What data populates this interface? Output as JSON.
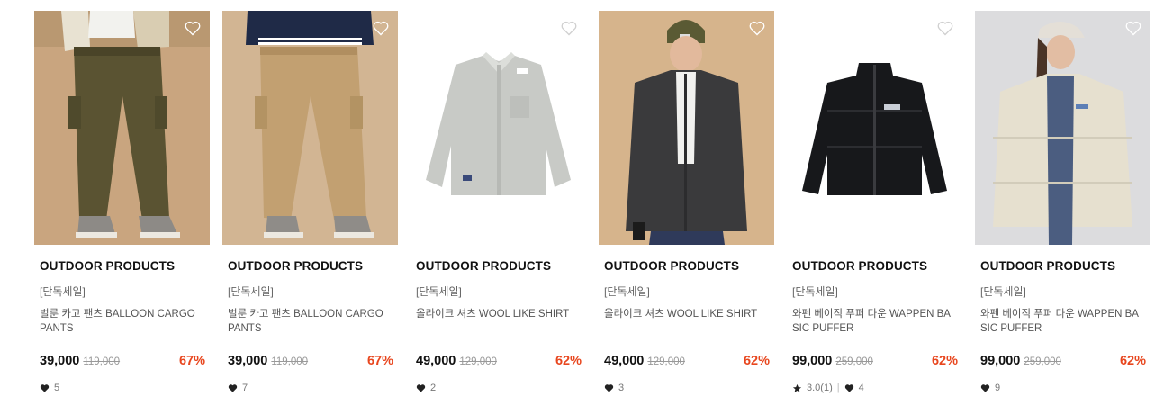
{
  "products": [
    {
      "brand": "OUTDOOR PRODUCTS",
      "tag": "[단독세일]",
      "name": "벌룬 카고 팬츠 BALLOON CARGO PANTS",
      "price": "39,000",
      "orig": "119,000",
      "discount": "67%",
      "likes": "5",
      "rating": "",
      "reviews": ""
    },
    {
      "brand": "OUTDOOR PRODUCTS",
      "tag": "[단독세일]",
      "name": "벌룬 카고 팬츠 BALLOON CARGO PANTS",
      "price": "39,000",
      "orig": "119,000",
      "discount": "67%",
      "likes": "7",
      "rating": "",
      "reviews": ""
    },
    {
      "brand": "OUTDOOR PRODUCTS",
      "tag": "[단독세일]",
      "name": "올라이크 셔츠 WOOL LIKE SHIRT",
      "price": "49,000",
      "orig": "129,000",
      "discount": "62%",
      "likes": "2",
      "rating": "",
      "reviews": ""
    },
    {
      "brand": "OUTDOOR PRODUCTS",
      "tag": "[단독세일]",
      "name": "올라이크 셔츠 WOOL LIKE SHIRT",
      "price": "49,000",
      "orig": "129,000",
      "discount": "62%",
      "likes": "3",
      "rating": "",
      "reviews": ""
    },
    {
      "brand": "OUTDOOR PRODUCTS",
      "tag": "[단독세일]",
      "name": "와펜 베이직 푸퍼 다운 WAPPEN BASIC PUFFER",
      "price": "99,000",
      "orig": "259,000",
      "discount": "62%",
      "likes": "4",
      "rating": "3.0",
      "reviews": "(1)"
    },
    {
      "brand": "OUTDOOR PRODUCTS",
      "tag": "[단독세일]",
      "name": "와펜 베이직 푸퍼 다운 WAPPEN BASIC PUFFER",
      "price": "99,000",
      "orig": "259,000",
      "discount": "62%",
      "likes": "9",
      "rating": "",
      "reviews": ""
    }
  ],
  "colors": {
    "discount": "#e8461e",
    "price": "#111111",
    "strike": "#999999"
  },
  "icons": {
    "wishlist": "heart-outline-icon",
    "likes": "heart-filled-icon",
    "rating": "star-icon"
  }
}
